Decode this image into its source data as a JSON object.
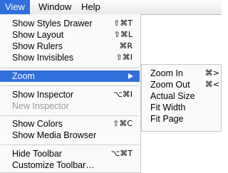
{
  "menubar": {
    "items": [
      "View",
      "Window",
      "Help"
    ]
  },
  "view_menu": {
    "items": [
      {
        "label": "Show Styles Drawer",
        "shortcut": "⇧⌘T"
      },
      {
        "label": "Show Layout",
        "shortcut": "⇧⌘L"
      },
      {
        "label": "Show Rulers",
        "shortcut": "⌘R"
      },
      {
        "label": "Show Invisibles",
        "shortcut": "⇧⌘I"
      },
      {
        "label": "Zoom",
        "shortcut": ""
      },
      {
        "label": "Show Inspector",
        "shortcut": "⌥⌘I"
      },
      {
        "label": "New Inspector",
        "shortcut": ""
      },
      {
        "label": "Show Colors",
        "shortcut": "⇧⌘C"
      },
      {
        "label": "Show Media Browser",
        "shortcut": ""
      },
      {
        "label": "Hide Toolbar",
        "shortcut": "⌥⌘T"
      },
      {
        "label": "Customize Toolbar…",
        "shortcut": ""
      }
    ]
  },
  "zoom_submenu": {
    "items": [
      {
        "label": "Zoom In",
        "shortcut": "⌘>"
      },
      {
        "label": "Zoom Out",
        "shortcut": "⌘<"
      },
      {
        "label": "Actual Size",
        "shortcut": ""
      },
      {
        "label": "Fit Width",
        "shortcut": ""
      },
      {
        "label": "Fit Page",
        "shortcut": ""
      }
    ]
  },
  "colors": {
    "highlight": "#2f6fdc",
    "disabled_text": "#9a9a9a"
  }
}
